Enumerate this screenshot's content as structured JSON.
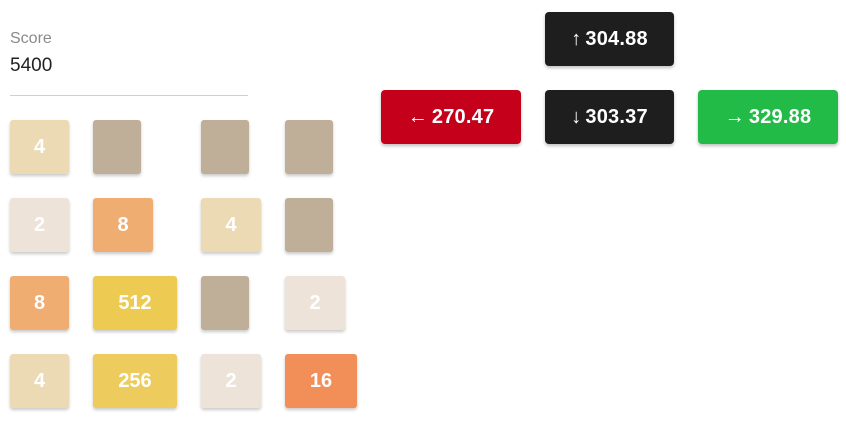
{
  "score": {
    "label": "Score",
    "value": "5400"
  },
  "board": {
    "rows": [
      [
        "4",
        "",
        "",
        ""
      ],
      [
        "2",
        "8",
        "4",
        ""
      ],
      [
        "8",
        "512",
        "",
        "2"
      ],
      [
        "4",
        "256",
        "2",
        "16"
      ]
    ],
    "colors": {
      "empty": "#bfae98",
      "2": "#ede3d8",
      "4": "#ecdab4",
      "8": "#f0ad72",
      "16": "#f28e58",
      "256": "#edcb5d",
      "512": "#edcb52"
    }
  },
  "moves": {
    "up": {
      "arrow": "↑",
      "value": "304.88",
      "color": "#1e1e1e"
    },
    "left": {
      "arrow": "←",
      "value": "270.47",
      "color": "#c4001a"
    },
    "down": {
      "arrow": "↓",
      "value": "303.37",
      "color": "#1e1e1e"
    },
    "right": {
      "arrow": "→",
      "value": "329.88",
      "color": "#22bb47"
    }
  }
}
